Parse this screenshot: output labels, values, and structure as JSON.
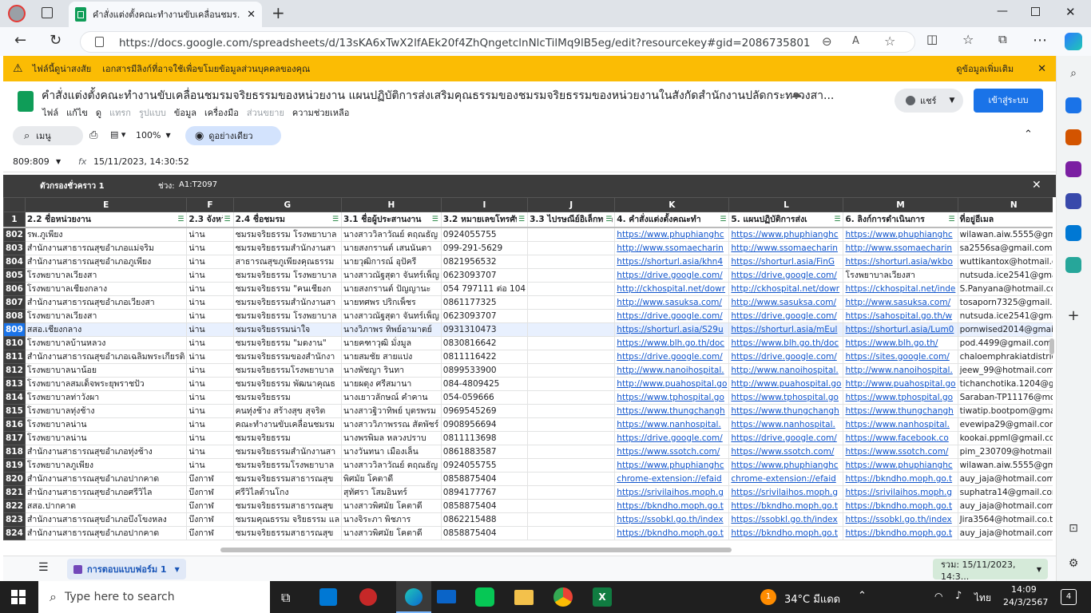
{
  "browser": {
    "tab_title": "คำสั่งแต่งตั้งคณะทำงานขับเคลื่อนชมร...",
    "url": "https://docs.google.com/spreadsheets/d/13sKA6xTwX2lfAEk20f4ZhQngetclnNlcTilMq9lB5eg/edit?resourcekey#gid=2086735801"
  },
  "warning": {
    "title": "ไฟล์นี้ดูน่าสงสัย",
    "message": "เอกสารมีลิงก์ที่อาจใช้เพื่อขโมยข้อมูลส่วนบุคคลของคุณ",
    "more_link": "ดูข้อมูลเพิ่มเติม"
  },
  "doc": {
    "title": "คำสั่งแต่งตั้งคณะทำงานขับเคลื่อนชมรมจริยธรรมของหน่วยงาน แผนปฏิบัติการส่งเสริมคุณธรรมของชมรมจริยธรรมของหน่วยงานในสังกัดสำนักงานปลัดกระทรวงสา...",
    "share_label": "แชร์",
    "signin_label": "เข้าสู่ระบบ",
    "menu": [
      "ไฟล์",
      "แก้ไข",
      "ดู",
      "แทรก",
      "รูปแบบ",
      "ข้อมูล",
      "เครื่องมือ",
      "ส่วนขยาย",
      "ความช่วยเหลือ"
    ]
  },
  "toolbar": {
    "search_label": "เมนู",
    "zoom": "100%",
    "view_only": "ดูอย่างเดียว"
  },
  "formula_bar": {
    "cell_ref": "809:809",
    "fx": "fx",
    "value": "15/11/2023, 14:30:52"
  },
  "filter_bar": {
    "name": "ตัวกรองชั่วคราว 1",
    "range_label": "ช่วง:",
    "range": "A1:T2097"
  },
  "columns": [
    "E",
    "F",
    "G",
    "H",
    "I",
    "J",
    "K",
    "L",
    "M",
    "N"
  ],
  "header_row": {
    "num": "1",
    "cells": [
      "2.2 ชื่อหน่วยงาน",
      "2.3 จังหวัด",
      "2.4 ชื่อชมรม",
      "3.1 ชื่อผู้ประสานงาน",
      "3.2 หมายเลขโทรศัพ",
      "3.3 ไปรษณีย์อิเล็กทรอ",
      "4. คำสั่งแต่งตั้งคณะทำ",
      "5. แผนปฏิบัติการส่งเ",
      "6. ลิงก์การดำเนินการ",
      "ที่อยู่อีเมล"
    ]
  },
  "rows": [
    {
      "num": "802",
      "cells": [
        "รพ.ภูเพียง",
        "น่าน",
        "ชมรมจริยธรรม โรงพยาบาล",
        "นางสาววิลาวัณย์ ตฤณธัญ",
        "0924055755",
        "",
        "https://www.phuphianghc",
        "https://www.phuphianghc",
        "https://www.phuphianghc",
        "wilawan.aiw.5555@gma"
      ]
    },
    {
      "num": "803",
      "cells": [
        "สำนักงานสาธารณสุขอำเภอแม่จริม",
        "น่าน",
        "ชมรมจริยธรรมสำนักงานสา",
        "นายสงกรานต์ เสนนันตา",
        "099-291-5629",
        "",
        "http://www.ssomaecharin",
        "http://www.ssomaecharin",
        "http://www.ssomaecharin",
        "sa2556sa@gmail.com"
      ]
    },
    {
      "num": "804",
      "cells": [
        "สำนักงานสาธารณสุขอำเภอภูเพียง",
        "น่าน",
        "สาธารณสุขภูเพียงคุณธรรม",
        "นายวุฒิการณ์ อุปัครี",
        "0821956532",
        "",
        "https://shorturl.asia/khn4",
        "https://shorturl.asia/FinG",
        "https://shorturl.asia/wkbo",
        "wuttikantox@hotmail.co"
      ]
    },
    {
      "num": "805",
      "cells": [
        "โรงพยาบาลเวียงสา",
        "น่าน",
        "ชมรมจริยธรรม โรงพยาบาล",
        "นางสาวณัฐสุดา จันทร์เพ็ญ",
        "0623093707",
        "",
        "https://drive.google.com/",
        "https://drive.google.com/",
        "โรงพยาบาลเวียงสา",
        "nutsuda.ice2541@gmail"
      ]
    },
    {
      "num": "806",
      "cells": [
        "โรงพยาบาลเชียงกลาง",
        "น่าน",
        "ชมรมจริยธรรม \"คนเชียงก",
        "นายสงกรานต์ ปัญญานะ",
        "054 797111 ต่อ 104",
        "",
        "http://ckhospital.net/dowr",
        "http://ckhospital.net/dowr",
        "https://ckhospital.net/inde",
        "S.Panyana@hotmail.co"
      ]
    },
    {
      "num": "807",
      "cells": [
        "สำนักงานสาธารณสุขอำเภอเวียงสา",
        "น่าน",
        "ชมรมจริยธรรมสำนักงานสา",
        "นายทศพร ปริกเพ็ชร",
        "0861177325",
        "",
        "http://www.sasuksa.com/",
        "http://www.sasuksa.com/",
        "http://www.sasuksa.com/",
        "tosaporn7325@gmail.co"
      ]
    },
    {
      "num": "808",
      "cells": [
        "โรงพยาบาลเวียงสา",
        "น่าน",
        "ชมรมจริยธรรม โรงพยาบาล",
        "นางสาวณัฐสุดา จันทร์เพ็ญ",
        "0623093707",
        "",
        "https://drive.google.com/",
        "https://drive.google.com/",
        "https://sahospital.go.th/w",
        "nutsuda.ice2541@gmail"
      ]
    },
    {
      "num": "809",
      "cells": [
        "สสอ.เชียงกลาง",
        "น่าน",
        "ชมรมจริยธรรมน่าใจ",
        "นางวิภาพร ทิพย์อามาตย์",
        "0931310473",
        "",
        "https://shorturl.asia/S29u",
        "https://shorturl.asia/mEul",
        "https://shorturl.asia/Lum0",
        "pornwised2014@gmail.c"
      ]
    },
    {
      "num": "810",
      "cells": [
        "โรงพยาบาลบ้านหลวง",
        "น่าน",
        "ชมรมจริยธรรม \"มดงาน\"",
        "นายคฑาวุฒิ มั่งมูล",
        "0830816642",
        "",
        "https://www.blh.go.th/doc",
        "https://www.blh.go.th/doc",
        "https://www.blh.go.th/",
        "pod.4499@gmail.com"
      ]
    },
    {
      "num": "811",
      "cells": [
        "สำนักงานสาธารณสุขอำเภอเฉลิมพระเกียรติ",
        "น่าน",
        "ชมรมจริยธรรมของสำนักงา",
        "นายสมชัย สายแปง",
        "0811116422",
        "",
        "https://drive.google.com/",
        "https://drive.google.com/",
        "https://sites.google.com/",
        "chaloemphrakiatdistrict@"
      ]
    },
    {
      "num": "812",
      "cells": [
        "โรงพยาบาลนาน้อย",
        "น่าน",
        "ชมรมจริยธรรมโรงพยาบาล",
        "นางพัชญา รินทา",
        "0899533900",
        "",
        "http://www.nanoihospital.",
        "http://www.nanoihospital.",
        "http://www.nanoihospital.",
        "jeew_99@hotmail.com"
      ]
    },
    {
      "num": "813",
      "cells": [
        "โรงพยาบาลสมเด็จพระยุพราชปัว",
        "น่าน",
        "ชมรมจริยธรรม พัฒนาคุณธ",
        "นายผดุง ศรีสมานา",
        "084-4809425",
        "",
        "http://www.puahospital.go",
        "http://www.puahospital.go",
        "http://www.puahospital.go",
        "tichanchotika.1204@gm"
      ]
    },
    {
      "num": "814",
      "cells": [
        "โรงพยาบาลท่าวังผา",
        "น่าน",
        "ชมรมจริยธรรม",
        "นางเยาวลักษณ์ คำคาน",
        "054-059666",
        "",
        "https://www.tphospital.go",
        "https://www.tphospital.go",
        "https://www.tphospital.go",
        "Saraban-TP11176@mo"
      ]
    },
    {
      "num": "815",
      "cells": [
        "โรงพยาบาลทุ่งช้าง",
        "น่าน",
        "คนทุ่งช้าง สร้างสุข สุจริต",
        "นางสาวฐิวาทิพย์ บุตรพรม",
        "0969545269",
        "",
        "https://www.thungchangh",
        "https://www.thungchangh",
        "https://www.thungchangh",
        "tiwatip.bootpom@gmail."
      ]
    },
    {
      "num": "816",
      "cells": [
        "โรงพยาบาลน่าน",
        "น่าน",
        "คณะทำงานขับเคลื่อนชมรม",
        "นางสาววิภาพรรณ สัตพัชร์",
        "0908956694",
        "",
        "https://www.nanhospital.",
        "https://www.nanhospital.",
        "https://www.nanhospital.",
        "evewipa29@gmail.com"
      ]
    },
    {
      "num": "817",
      "cells": [
        "โรงพยาบาลน่าน",
        "น่าน",
        "ชมรมจริยธรรม",
        "นางพรพิมล หลวงปราบ",
        "0811113698",
        "",
        "https://drive.google.com/",
        "https://drive.google.com/",
        "https://www.facebook.co",
        "kookai.ppml@gmail.com"
      ]
    },
    {
      "num": "818",
      "cells": [
        "สำนักงานสาธารณสุขอำเภอทุ่งช้าง",
        "น่าน",
        "ชมรมจริยธรรมสำนักงานสา",
        "นางวันทนา เมืองเล็น",
        "0861883587",
        "",
        "https://www.ssotch.com/",
        "https://www.ssotch.com/",
        "https://www.ssotch.com/",
        "pim_230709@hotmail.co"
      ]
    },
    {
      "num": "819",
      "cells": [
        "โรงพยาบาลภูเพียง",
        "น่าน",
        "ชมรมจริยธรรมโรงพยาบาล",
        "นางสาววิลาวัณย์ ตฤณธัญ",
        "0924055755",
        "",
        "https://www.phuphianghc",
        "https://www.phuphianghc",
        "https://www.phuphianghc",
        "wilawan.aiw.5555@gma"
      ]
    },
    {
      "num": "820",
      "cells": [
        "สำนักงานสาธารณสุขอำเภอปากคาด",
        "บึงกาฬ",
        "ชมรมจริยธรรมสาธารณสุข",
        "พิศมัย โคตาดี",
        "0858875404",
        "",
        "chrome-extension://efaid",
        "chrome-extension://efaid",
        "https://bkndho.moph.go.t",
        "auy_jaja@hotmail.com"
      ]
    },
    {
      "num": "821",
      "cells": [
        "สำนักงานสาธารณสุขอำเภอศรีวิไล",
        "บึงกาฬ",
        "ศรีวิไลต้านโกง",
        "สุทัศรา โสมอินทร์",
        "0894177767",
        "",
        "https://srivilaihos.moph.g",
        "https://srivilaihos.moph.g",
        "https://srivilaihos.moph.g",
        "suphatra14@gmail.com"
      ]
    },
    {
      "num": "822",
      "cells": [
        "สสอ.ปากคาด",
        "บึงกาฬ",
        "ชมรมจริยธรรมสาธารณสุข",
        "นางสาวพิศมัย โคตาดี",
        "0858875404",
        "",
        "https://bkndho.moph.go.t",
        "https://bkndho.moph.go.t",
        "https://bkndho.moph.go.t",
        "auy_jaja@hotmail.com"
      ]
    },
    {
      "num": "823",
      "cells": [
        "สำนักงานสาธารณสุขอำเภอบึงโขงหลง",
        "บึงกาฬ",
        "ชมรมคุณธรรม จริยธรรม แล",
        "นางจิระภา พิชภาร",
        "0862215488",
        "",
        "https://ssobkl.go.th/index",
        "https://ssobkl.go.th/index",
        "https://ssobkl.go.th/index",
        "Jira3564@hotmail.co.th"
      ]
    },
    {
      "num": "824",
      "cells": [
        "สำนักงานสาธารณสุขอำเภอปากคาด",
        "บึงกาฬ",
        "ชมรมจริยธรรมสาธารณสุข",
        "นางสาวพิศมัย โคตาดี",
        "0858875404",
        "",
        "https://bkndho.moph.go.t",
        "https://bkndho.moph.go.t",
        "https://bkndho.moph.go.t",
        "auy_jaja@hotmail.com"
      ]
    }
  ],
  "sheet_tab": "การตอบแบบฟอร์ม 1",
  "sum_label": "รวม: 15/11/2023, 14:3...",
  "taskbar": {
    "search_placeholder": "Type here to search",
    "weather": "34°C มีแดด",
    "notification_count": "1",
    "lang": "ไทย",
    "time": "14:09",
    "date": "24/3/2567",
    "badge": "4"
  }
}
